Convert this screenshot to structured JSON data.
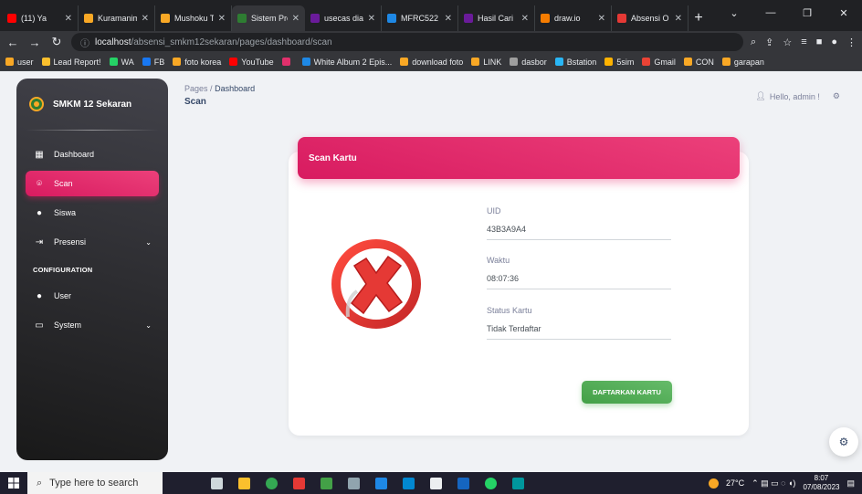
{
  "browser": {
    "tabs": [
      {
        "label": "(11) Ya",
        "color": "#ff0000"
      },
      {
        "label": "Kuramanime",
        "color": "#f9a825"
      },
      {
        "label": "Mushoku T",
        "color": "#f9a825"
      },
      {
        "label": "Sistem Pre",
        "color": "#2e7d32",
        "active": true
      },
      {
        "label": "usecas dia",
        "color": "#6a1b9a"
      },
      {
        "label": "MFRC522",
        "color": "#1e88e5"
      },
      {
        "label": "Hasil Cari",
        "color": "#6a1b9a"
      },
      {
        "label": "draw.io",
        "color": "#f57c00"
      },
      {
        "label": "Absensi O",
        "color": "#e53935"
      }
    ],
    "new_tab": "+",
    "url_host": "localhost",
    "url_path": "/absensi_smkm12sekaran/pages/dashboard/scan",
    "bookmarks": [
      {
        "label": "user",
        "color": "#f9a825"
      },
      {
        "label": "Lead Report!",
        "color": "#fbc02d"
      },
      {
        "label": "WA",
        "color": "#25d366"
      },
      {
        "label": "FB",
        "color": "#1877f2"
      },
      {
        "label": "foto korea",
        "color": "#f9a825"
      },
      {
        "label": "YouTube",
        "color": "#ff0000"
      },
      {
        "label": "",
        "color": "#e1306c"
      },
      {
        "label": "White Album 2 Epis...",
        "color": "#1e88e5"
      },
      {
        "label": "download foto",
        "color": "#f9a825"
      },
      {
        "label": "LINK",
        "color": "#f9a825"
      },
      {
        "label": "dasbor",
        "color": "#9e9e9e"
      },
      {
        "label": "Bstation",
        "color": "#29b6f6"
      },
      {
        "label": "5sim",
        "color": "#ffb300"
      },
      {
        "label": "Gmail",
        "color": "#ea4335"
      },
      {
        "label": "CON",
        "color": "#f9a825"
      },
      {
        "label": "garapan",
        "color": "#f9a825"
      }
    ]
  },
  "sidebar": {
    "brand": "SMKM 12 Sekaran",
    "items": [
      {
        "label": "Dashboard",
        "icon": "dashboard-icon",
        "glyph": "▦"
      },
      {
        "label": "Scan",
        "icon": "scan-icon",
        "glyph": "⌾",
        "active": true
      },
      {
        "label": "Siswa",
        "icon": "person-icon",
        "glyph": "●"
      },
      {
        "label": "Presensi",
        "icon": "login-icon",
        "glyph": "⇥",
        "chevron": true
      }
    ],
    "config_heading": "CONFIGURATION",
    "config_items": [
      {
        "label": "User",
        "icon": "users-icon",
        "glyph": "●"
      },
      {
        "label": "System",
        "icon": "monitor-icon",
        "glyph": "▭",
        "chevron": true
      }
    ]
  },
  "header": {
    "breadcrumb_root": "Pages",
    "breadcrumb_sep": "/",
    "breadcrumb_current": "Dashboard",
    "title": "Scan",
    "greeting": "Hello, admin !"
  },
  "card": {
    "title": "Scan Kartu",
    "fields": {
      "uid_label": "UID",
      "uid_value": "43B3A9A4",
      "waktu_label": "Waktu",
      "waktu_value": "08:07:36",
      "status_label": "Status Kartu",
      "status_value": "Tidak Terdaftar"
    },
    "button": "DAFTARKAN KARTU"
  },
  "taskbar": {
    "search_placeholder": "Type here to search",
    "temperature": "27°C",
    "time": "8:07",
    "date": "07/08/2023"
  },
  "colors": {
    "accent_pink": "#e91e63",
    "success_green": "#4caf50",
    "error_red": "#e53935"
  }
}
